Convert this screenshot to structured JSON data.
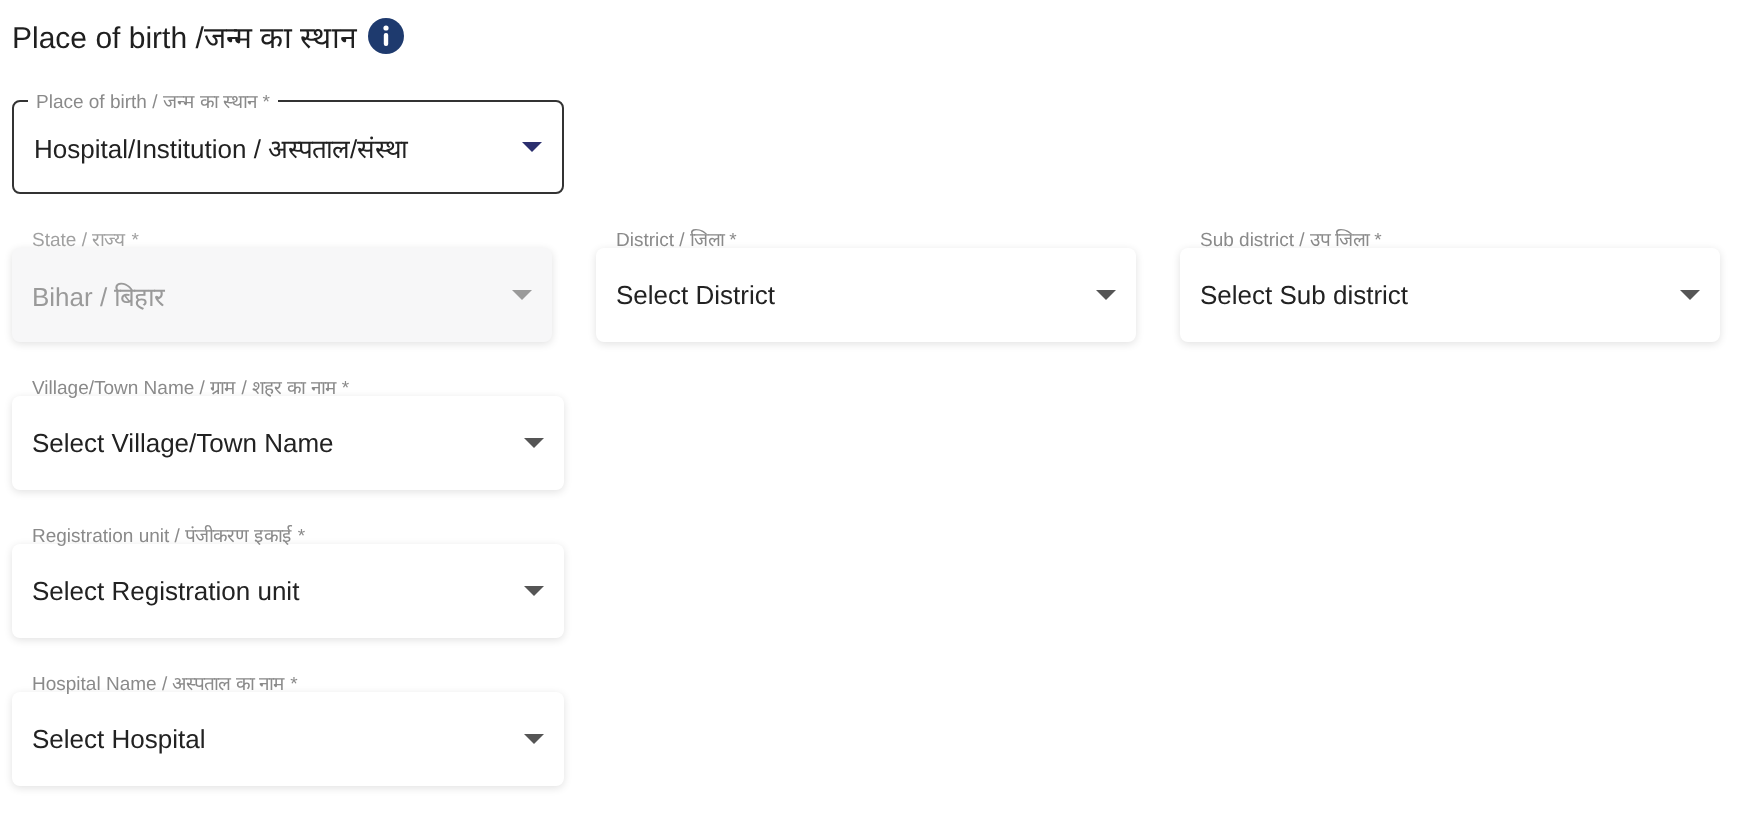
{
  "section": {
    "title": "Place of birth /जन्म का स्थान"
  },
  "rows": [
    [
      {
        "label": "Place of birth / जन्म का स्थान *",
        "value": "Hospital/Institution / अस्पताल/संस्था",
        "focused": true,
        "disabled": false
      }
    ],
    [
      {
        "label": "State / राज्य *",
        "value": "Bihar / बिहार",
        "focused": false,
        "disabled": true
      },
      {
        "label": "District / जिला *",
        "value": "Select District",
        "focused": false,
        "disabled": false
      },
      {
        "label": "Sub district / उप जिला *",
        "value": "Select Sub district",
        "focused": false,
        "disabled": false
      }
    ],
    [
      {
        "label": "Village/Town Name / ग्राम / शहर का नाम *",
        "value": "Select Village/Town Name",
        "focused": false,
        "disabled": false
      }
    ],
    [
      {
        "label": "Registration unit / पंजीकरण इकाई *",
        "value": "Select Registration unit",
        "focused": false,
        "disabled": false
      }
    ],
    [
      {
        "label": "Hospital Name / अस्पताल का नाम *",
        "value": "Select Hospital",
        "focused": false,
        "disabled": false
      }
    ]
  ]
}
